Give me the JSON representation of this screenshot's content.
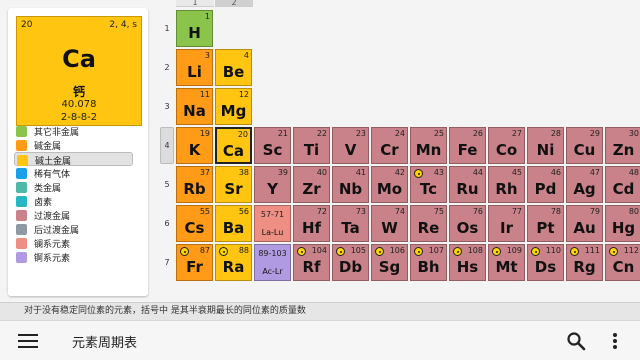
{
  "colors": {
    "other_nonmetal": "#8ac44a",
    "alkali_metal": "#ff9b17",
    "alkaline_earth": "#ffc510",
    "noble_gas": "#1aa0e8",
    "metalloid": "#4fb8a8",
    "halogen": "#26b7c3",
    "transition_metal": "#c98289",
    "post_transition": "#8d9aa4",
    "lanthanide": "#ee8f84",
    "actinide": "#b09ae2"
  },
  "selected": {
    "number": "20",
    "shells_short": "2, 4, s",
    "symbol": "Ca",
    "name": "钙",
    "mass": "40.078",
    "config": "2-8-8-2"
  },
  "legend": [
    {
      "label": "其它非金属",
      "color": "#8ac44a"
    },
    {
      "label": "碱金属",
      "color": "#ff9b17"
    },
    {
      "label": "碱土金属",
      "color": "#ffc510"
    },
    {
      "label": "稀有气体",
      "color": "#1aa0e8"
    },
    {
      "label": "类金属",
      "color": "#4fb8a8"
    },
    {
      "label": "卤素",
      "color": "#26b7c3"
    },
    {
      "label": "过渡金属",
      "color": "#c98289"
    },
    {
      "label": "后过渡金属",
      "color": "#8d9aa4"
    },
    {
      "label": "镧系元素",
      "color": "#ee8f84"
    },
    {
      "label": "锕系元素",
      "color": "#b09ae2"
    }
  ],
  "group_headers": [
    "1",
    "2"
  ],
  "periods": [
    "1",
    "2",
    "3",
    "4",
    "5",
    "6",
    "7"
  ],
  "elements": [
    {
      "n": "1",
      "s": "H",
      "cat": "other_nonmetal",
      "col": 1,
      "row": 1
    },
    {
      "n": "3",
      "s": "Li",
      "cat": "alkali_metal",
      "col": 1,
      "row": 2
    },
    {
      "n": "4",
      "s": "Be",
      "cat": "alkaline_earth",
      "col": 2,
      "row": 2
    },
    {
      "n": "11",
      "s": "Na",
      "cat": "alkali_metal",
      "col": 1,
      "row": 3
    },
    {
      "n": "12",
      "s": "Mg",
      "cat": "alkaline_earth",
      "col": 2,
      "row": 3
    },
    {
      "n": "19",
      "s": "K",
      "cat": "alkali_metal",
      "col": 1,
      "row": 4
    },
    {
      "n": "20",
      "s": "Ca",
      "cat": "alkaline_earth",
      "col": 2,
      "row": 4,
      "selected": true
    },
    {
      "n": "21",
      "s": "Sc",
      "cat": "transition_metal",
      "col": 3,
      "row": 4
    },
    {
      "n": "22",
      "s": "Ti",
      "cat": "transition_metal",
      "col": 4,
      "row": 4
    },
    {
      "n": "23",
      "s": "V",
      "cat": "transition_metal",
      "col": 5,
      "row": 4
    },
    {
      "n": "24",
      "s": "Cr",
      "cat": "transition_metal",
      "col": 6,
      "row": 4
    },
    {
      "n": "25",
      "s": "Mn",
      "cat": "transition_metal",
      "col": 7,
      "row": 4
    },
    {
      "n": "26",
      "s": "Fe",
      "cat": "transition_metal",
      "col": 8,
      "row": 4
    },
    {
      "n": "27",
      "s": "Co",
      "cat": "transition_metal",
      "col": 9,
      "row": 4
    },
    {
      "n": "28",
      "s": "Ni",
      "cat": "transition_metal",
      "col": 10,
      "row": 4
    },
    {
      "n": "29",
      "s": "Cu",
      "cat": "transition_metal",
      "col": 11,
      "row": 4
    },
    {
      "n": "30",
      "s": "Zn",
      "cat": "transition_metal",
      "col": 12,
      "row": 4
    },
    {
      "n": "37",
      "s": "Rb",
      "cat": "alkali_metal",
      "col": 1,
      "row": 5
    },
    {
      "n": "38",
      "s": "Sr",
      "cat": "alkaline_earth",
      "col": 2,
      "row": 5
    },
    {
      "n": "39",
      "s": "Y",
      "cat": "transition_metal",
      "col": 3,
      "row": 5
    },
    {
      "n": "40",
      "s": "Zr",
      "cat": "transition_metal",
      "col": 4,
      "row": 5
    },
    {
      "n": "41",
      "s": "Nb",
      "cat": "transition_metal",
      "col": 5,
      "row": 5
    },
    {
      "n": "42",
      "s": "Mo",
      "cat": "transition_metal",
      "col": 6,
      "row": 5
    },
    {
      "n": "43",
      "s": "Tc",
      "cat": "transition_metal",
      "col": 7,
      "row": 5,
      "rad": true
    },
    {
      "n": "44",
      "s": "Ru",
      "cat": "transition_metal",
      "col": 8,
      "row": 5
    },
    {
      "n": "45",
      "s": "Rh",
      "cat": "transition_metal",
      "col": 9,
      "row": 5
    },
    {
      "n": "46",
      "s": "Pd",
      "cat": "transition_metal",
      "col": 10,
      "row": 5
    },
    {
      "n": "47",
      "s": "Ag",
      "cat": "transition_metal",
      "col": 11,
      "row": 5
    },
    {
      "n": "48",
      "s": "Cd",
      "cat": "transition_metal",
      "col": 12,
      "row": 5
    },
    {
      "n": "55",
      "s": "Cs",
      "cat": "alkali_metal",
      "col": 1,
      "row": 6
    },
    {
      "n": "56",
      "s": "Ba",
      "cat": "alkaline_earth",
      "col": 2,
      "row": 6
    },
    {
      "n": "57-71",
      "s": "La-Lu",
      "cat": "lanthanide",
      "col": 3,
      "row": 6,
      "range": true
    },
    {
      "n": "72",
      "s": "Hf",
      "cat": "transition_metal",
      "col": 4,
      "row": 6
    },
    {
      "n": "73",
      "s": "Ta",
      "cat": "transition_metal",
      "col": 5,
      "row": 6
    },
    {
      "n": "74",
      "s": "W",
      "cat": "transition_metal",
      "col": 6,
      "row": 6
    },
    {
      "n": "75",
      "s": "Re",
      "cat": "transition_metal",
      "col": 7,
      "row": 6
    },
    {
      "n": "76",
      "s": "Os",
      "cat": "transition_metal",
      "col": 8,
      "row": 6
    },
    {
      "n": "77",
      "s": "Ir",
      "cat": "transition_metal",
      "col": 9,
      "row": 6
    },
    {
      "n": "78",
      "s": "Pt",
      "cat": "transition_metal",
      "col": 10,
      "row": 6
    },
    {
      "n": "79",
      "s": "Au",
      "cat": "transition_metal",
      "col": 11,
      "row": 6
    },
    {
      "n": "80",
      "s": "Hg",
      "cat": "transition_metal",
      "col": 12,
      "row": 6
    },
    {
      "n": "87",
      "s": "Fr",
      "cat": "alkali_metal",
      "col": 1,
      "row": 7,
      "rad": true
    },
    {
      "n": "88",
      "s": "Ra",
      "cat": "alkaline_earth",
      "col": 2,
      "row": 7,
      "rad": true
    },
    {
      "n": "89-103",
      "s": "Ac-Lr",
      "cat": "actinide",
      "col": 3,
      "row": 7,
      "range": true
    },
    {
      "n": "104",
      "s": "Rf",
      "cat": "transition_metal",
      "col": 4,
      "row": 7,
      "rad": true
    },
    {
      "n": "105",
      "s": "Db",
      "cat": "transition_metal",
      "col": 5,
      "row": 7,
      "rad": true
    },
    {
      "n": "106",
      "s": "Sg",
      "cat": "transition_metal",
      "col": 6,
      "row": 7,
      "rad": true
    },
    {
      "n": "107",
      "s": "Bh",
      "cat": "transition_metal",
      "col": 7,
      "row": 7,
      "rad": true
    },
    {
      "n": "108",
      "s": "Hs",
      "cat": "transition_metal",
      "col": 8,
      "row": 7,
      "rad": true
    },
    {
      "n": "109",
      "s": "Mt",
      "cat": "transition_metal",
      "col": 9,
      "row": 7,
      "rad": true
    },
    {
      "n": "110",
      "s": "Ds",
      "cat": "transition_metal",
      "col": 10,
      "row": 7,
      "rad": true
    },
    {
      "n": "111",
      "s": "Rg",
      "cat": "transition_metal",
      "col": 11,
      "row": 7,
      "rad": true
    },
    {
      "n": "112",
      "s": "Cn",
      "cat": "transition_metal",
      "col": 12,
      "row": 7,
      "rad": true
    }
  ],
  "footnote": "对于没有稳定同位素的元素，括号中 是其半衰期最长的同位素的质量数",
  "app_title": "元素周期表",
  "icons": {
    "menu": "menu-icon",
    "search": "search-icon",
    "more": "more-vert-icon",
    "radioactive": "radioactive-icon"
  }
}
